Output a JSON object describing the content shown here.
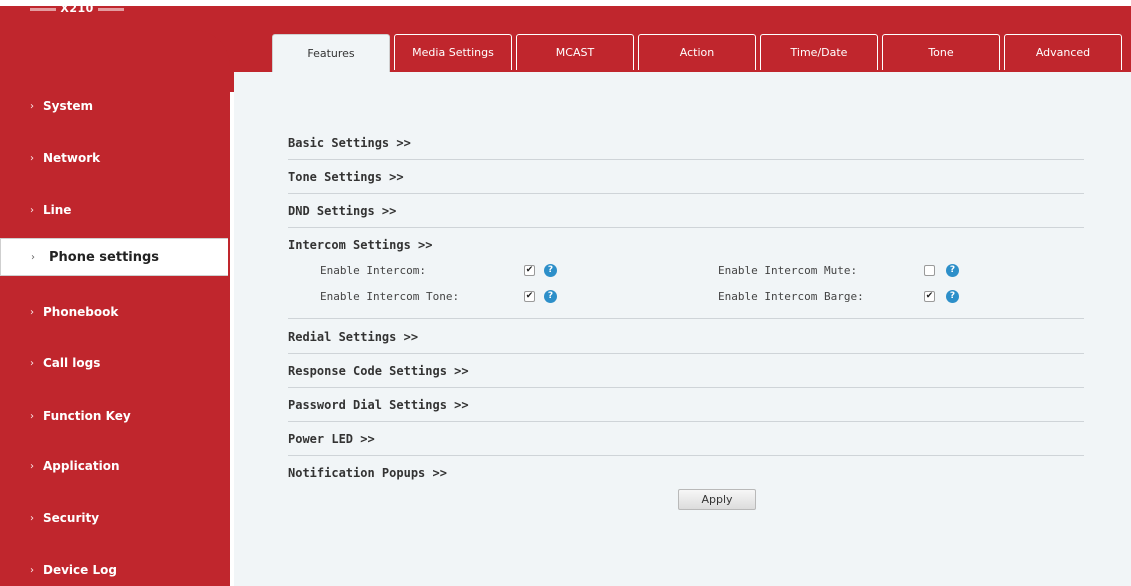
{
  "header": {
    "model": "X210"
  },
  "sidebar": {
    "items": [
      {
        "label": "System"
      },
      {
        "label": "Network"
      },
      {
        "label": "Line"
      },
      {
        "label": "Phone settings"
      },
      {
        "label": "Phonebook"
      },
      {
        "label": "Call logs"
      },
      {
        "label": "Function Key"
      },
      {
        "label": "Application"
      },
      {
        "label": "Security"
      },
      {
        "label": "Device Log"
      }
    ],
    "active": "Phone settings",
    "chevron": "›"
  },
  "tabs": [
    {
      "label": "Features"
    },
    {
      "label": "Media Settings"
    },
    {
      "label": "MCAST"
    },
    {
      "label": "Action"
    },
    {
      "label": "Time/Date"
    },
    {
      "label": "Tone"
    },
    {
      "label": "Advanced"
    }
  ],
  "active_tab": "Features",
  "sections": {
    "basic": "Basic Settings >>",
    "tone": "Tone Settings >>",
    "dnd": "DND Settings >>",
    "intercom": "Intercom Settings >>",
    "redial": "Redial Settings >>",
    "response": "Response Code Settings >>",
    "password": "Password Dial Settings >>",
    "power_led": "Power LED >>",
    "notification": "Notification Popups >>"
  },
  "intercom_fields": [
    {
      "label": "Enable Intercom:",
      "checked": true
    },
    {
      "label": "Enable Intercom Mute:",
      "checked": false
    },
    {
      "label": "Enable Intercom Tone:",
      "checked": true
    },
    {
      "label": "Enable Intercom Barge:",
      "checked": true
    }
  ],
  "help_glyph": "?",
  "check_glyph": "✔",
  "apply_label": "Apply",
  "colors": {
    "brand_red": "#c0262d",
    "panel_bg": "#f1f5f7",
    "help_blue": "#2d8fc9"
  }
}
